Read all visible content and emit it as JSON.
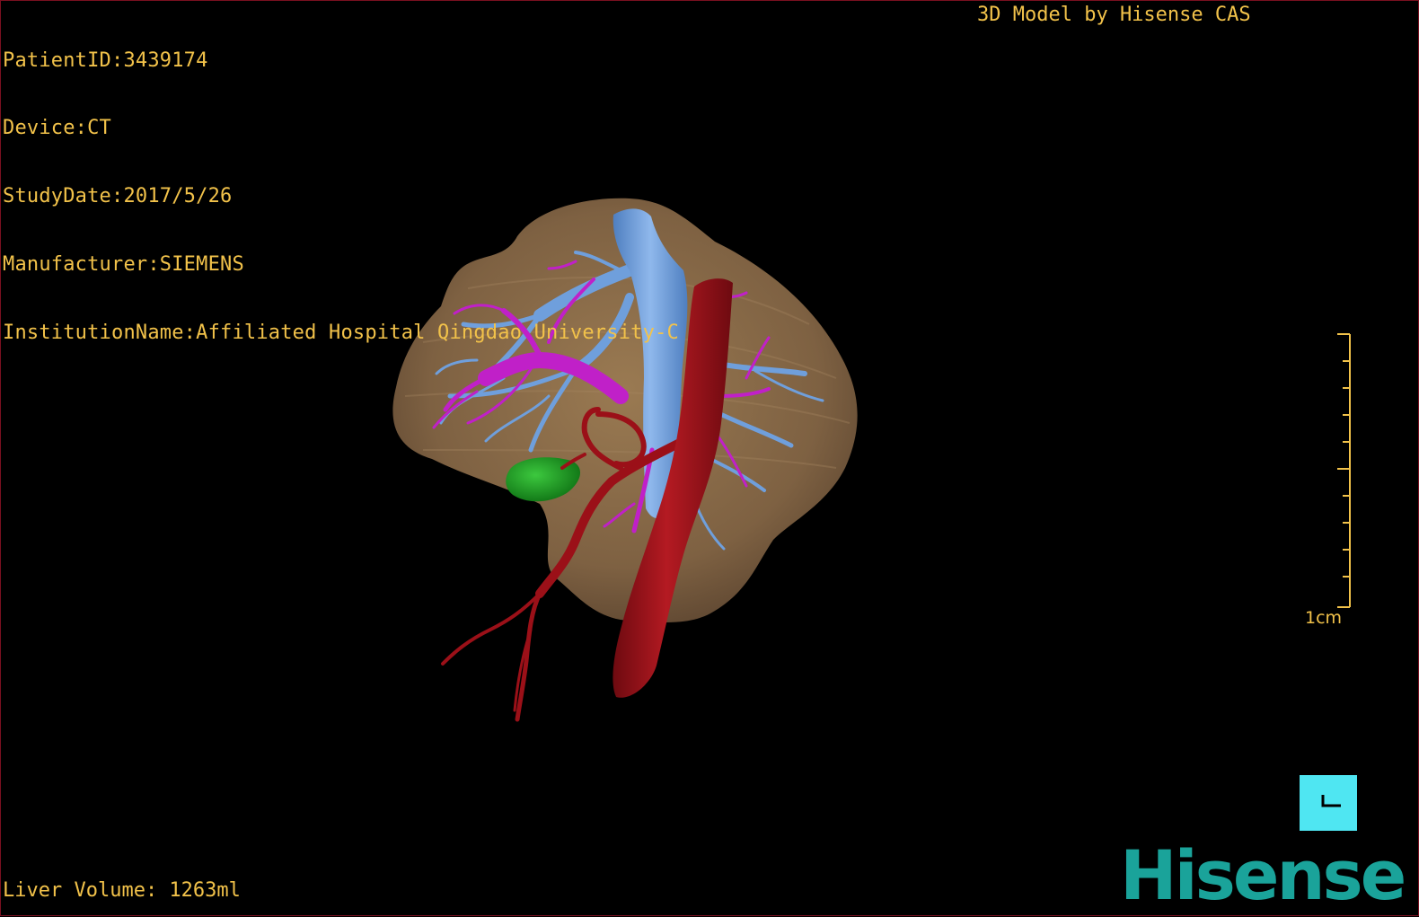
{
  "info": {
    "patient_id": "PatientID:3439174",
    "device": "Device:CT",
    "study_date": "StudyDate:2017/5/26",
    "manufacturer": "Manufacturer:SIEMENS",
    "institution": "InstitutionName:Affiliated Hospital Qingdao University-C"
  },
  "brand_tag": "3D Model by Hisense CAS",
  "liver_volume": "Liver Volume: 1263ml",
  "scale": {
    "label": "1cm"
  },
  "logo": "Hisense",
  "colors": {
    "overlay_text": "#f2c24a",
    "liver": "#8a6a45",
    "portal_vein": "#6f9fdc",
    "hepatic_vessels": "#c020c8",
    "artery": "#9b1018",
    "gallbladder": "#1f9a24",
    "corner_button": "#4fe6f2",
    "logo": "#1aa39a"
  },
  "icons": {
    "corner_button": "corner-bracket-icon"
  }
}
